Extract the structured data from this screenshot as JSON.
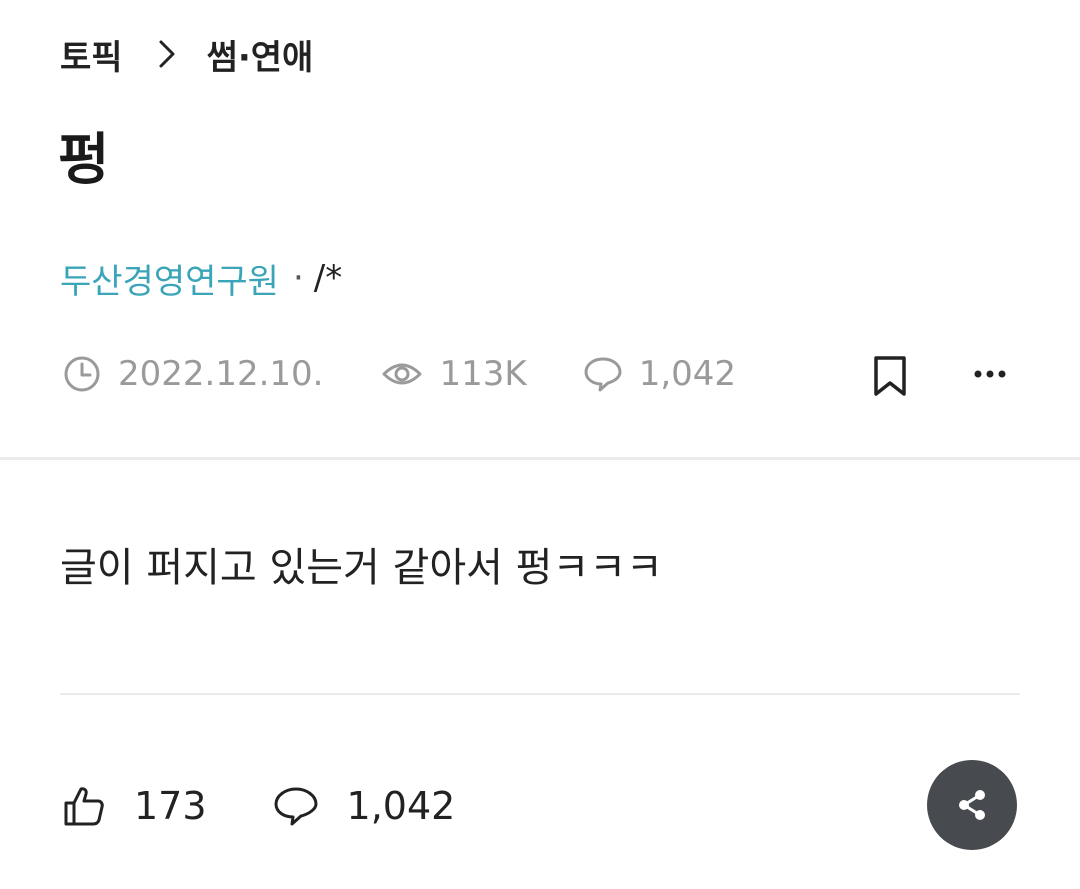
{
  "breadcrumb": {
    "root": "토픽",
    "current": "썸·연애"
  },
  "post": {
    "title": "펑",
    "author": "두산경영연구원",
    "separator": "·",
    "company": "/*",
    "date": "2022.12.10.",
    "views": "113K",
    "comment_count": "1,042",
    "body": "글이 퍼지고 있는거 같아서 펑ㅋㅋㅋ"
  },
  "actions": {
    "likes": "173",
    "comments": "1,042"
  },
  "icons": {
    "breadcrumb_sep": "chevron-right-icon",
    "date": "clock-icon",
    "views": "eye-icon",
    "comments": "speech-bubble-icon",
    "bookmark": "bookmark-icon",
    "more": "more-horizontal-icon",
    "like": "thumbs-up-icon",
    "share": "share-icon"
  },
  "colors": {
    "author": "#3aa4b8",
    "meta": "#9a9a9a",
    "share_bg": "#474a4e"
  }
}
